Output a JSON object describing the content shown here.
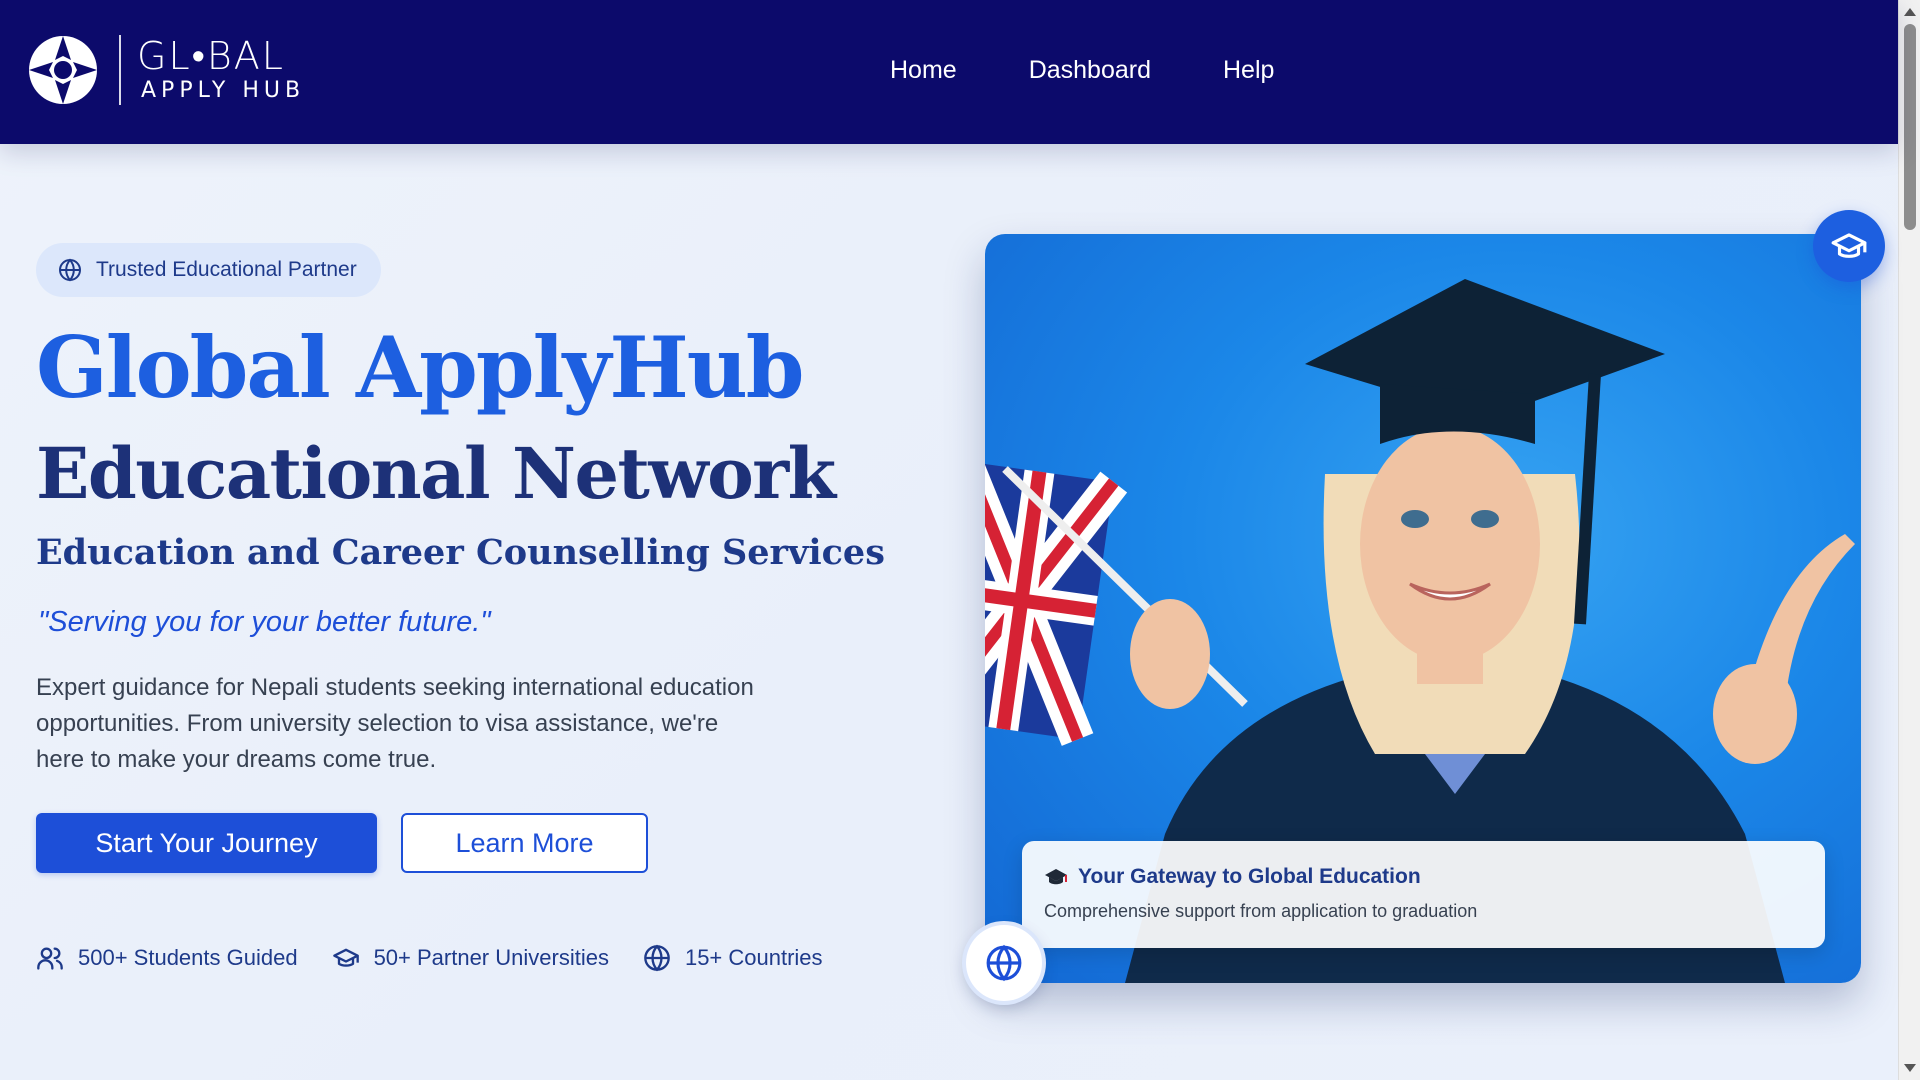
{
  "brand": {
    "line1": "GL•BAL",
    "line2": "APPLY HUB",
    "logo_icon": "globe-sun-icon"
  },
  "nav": {
    "items": [
      {
        "label": "Home"
      },
      {
        "label": "Dashboard"
      },
      {
        "label": "Help"
      }
    ]
  },
  "hero": {
    "badge": "Trusted Educational Partner",
    "title": "Global ApplyHub",
    "subtitle": "Educational Network",
    "services": "Education and Career Counselling Services",
    "tagline": "\"Serving you for your better future.\"",
    "description": "Expert guidance for Nepali students seeking international education opportunities. From university selection to visa assistance, we're here to make your dreams come true.",
    "primary_button": "Start Your Journey",
    "secondary_button": "Learn More",
    "stats": [
      {
        "icon": "users-icon",
        "label": "500+ Students Guided"
      },
      {
        "icon": "graduation-cap-icon",
        "label": "50+ Partner Universities"
      },
      {
        "icon": "globe-icon",
        "label": "15+ Countries"
      }
    ]
  },
  "image_card": {
    "caption_title": "Your Gateway to Global Education",
    "caption_subtitle": "Comprehensive support from application to graduation"
  },
  "colors": {
    "header_bg": "#0c0a6b",
    "accent": "#1d4fd8",
    "title_blue": "#1d5fe0",
    "navy": "#1e3a8a"
  }
}
